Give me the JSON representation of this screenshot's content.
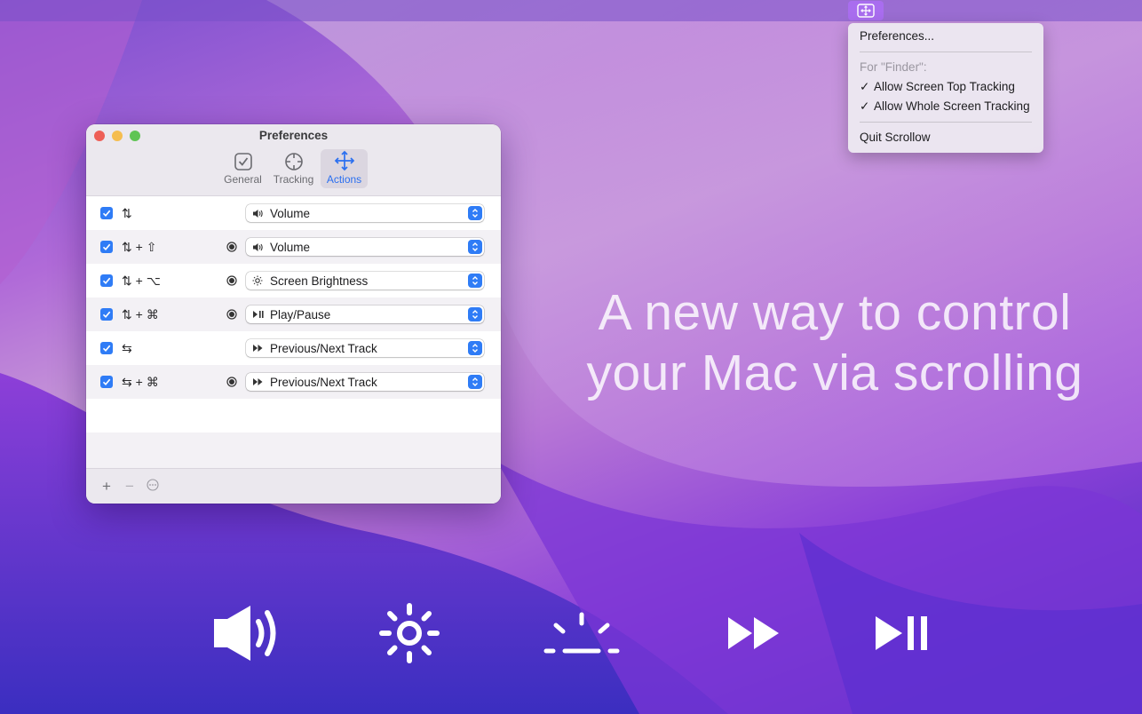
{
  "menubar": {
    "app_icon": "scrollow-move-icon",
    "menu": {
      "preferences": "Preferences...",
      "section_label": "For \"Finder\":",
      "top_tracking": "Allow Screen Top Tracking",
      "whole_tracking": "Allow Whole Screen Tracking",
      "quit": "Quit Scrollow",
      "check": "✓"
    }
  },
  "headline": {
    "line1": "A new way to control",
    "line2": "your Mac via scrolling"
  },
  "window": {
    "title": "Preferences",
    "tabs": [
      {
        "label": "General",
        "icon": "checkmark-square-icon"
      },
      {
        "label": "Tracking",
        "icon": "crosshair-icon"
      },
      {
        "label": "Actions",
        "icon": "move-arrows-icon",
        "active": true
      }
    ],
    "rows": [
      {
        "gesture": "⇅",
        "modifier": "",
        "action": "Volume",
        "icon": "speaker-icon"
      },
      {
        "gesture": "⇅",
        "modifier": "+ ⇧",
        "action": "Volume",
        "icon": "speaker-icon"
      },
      {
        "gesture": "⇅",
        "modifier": "+ ⌥",
        "action": "Screen Brightness",
        "icon": "sun-icon"
      },
      {
        "gesture": "⇅",
        "modifier": "+ ⌘",
        "action": "Play/Pause",
        "icon": "play-pause-icon"
      },
      {
        "gesture": "⇆",
        "modifier": "",
        "action": "Previous/Next Track",
        "icon": "fast-forward-icon"
      },
      {
        "gesture": "⇆",
        "modifier": "+ ⌘",
        "action": "Previous/Next Track",
        "icon": "fast-forward-icon"
      }
    ],
    "footer": {
      "add": "+",
      "remove": "−",
      "more": "⋯"
    }
  },
  "colors": {
    "accent": "#2f7cf6",
    "close": "#ee5f57",
    "minimize": "#f5bd4f",
    "zoom": "#5fc454"
  },
  "big_icons": [
    "speaker-icon",
    "sun-icon",
    "keyboard-brightness-icon",
    "fast-forward-icon",
    "play-pause-icon"
  ]
}
